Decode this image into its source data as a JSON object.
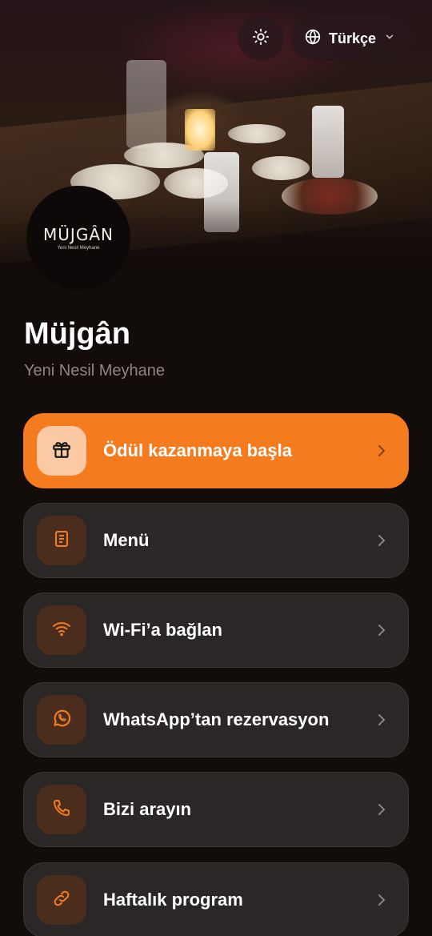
{
  "header": {
    "theme_toggle_icon": "sun-icon",
    "language": {
      "label": "Türkçe",
      "icon": "globe-icon",
      "dropdown_icon": "chevron-down-icon"
    }
  },
  "logo": {
    "word": "MÜJGÂN",
    "tagline": "Yeni Nesil Meyhane"
  },
  "venue": {
    "name": "Müjgân",
    "tagline": "Yeni Nesil Meyhane"
  },
  "actions": [
    {
      "label": "Ödül kazanmaya başla",
      "icon": "gift-icon",
      "primary": true
    },
    {
      "label": "Menü",
      "icon": "document-icon",
      "primary": false
    },
    {
      "label": "Wi-Fi’a bağlan",
      "icon": "wifi-icon",
      "primary": false
    },
    {
      "label": "WhatsApp’tan rezervasyon",
      "icon": "whatsapp-icon",
      "primary": false
    },
    {
      "label": "Bizi arayın",
      "icon": "phone-icon",
      "primary": false
    },
    {
      "label": "Haftalık program",
      "icon": "link-icon",
      "primary": false
    }
  ],
  "colors": {
    "accent": "#f57b1f",
    "background": "#120c0a",
    "card": "#2b2726",
    "icon_tile": "#4a2d1d",
    "muted_text": "#8f8682"
  }
}
